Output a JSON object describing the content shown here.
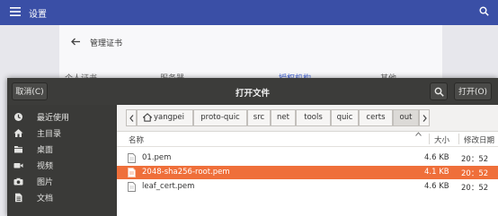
{
  "settings": {
    "title": "设置",
    "page_heading": "管理证书",
    "tabs": [
      {
        "label": "个人证书",
        "active": false
      },
      {
        "label": "服务器",
        "active": false
      },
      {
        "label": "授权机构",
        "active": true
      },
      {
        "label": "其他",
        "active": false
      }
    ]
  },
  "dialog": {
    "title": "打开文件",
    "cancel_label": "取消(C)",
    "open_label": "打开(O)",
    "search_icon": "search-icon",
    "sidebar": [
      {
        "label": "最近使用",
        "icon": "recent-icon"
      },
      {
        "label": "主目录",
        "icon": "home-icon"
      },
      {
        "label": "桌面",
        "icon": "folder-icon"
      },
      {
        "label": "视频",
        "icon": "video-icon"
      },
      {
        "label": "图片",
        "icon": "camera-icon"
      },
      {
        "label": "文档",
        "icon": "document-icon"
      }
    ],
    "breadcrumb": [
      {
        "label": "yangpei",
        "icon": "home-icon",
        "current": false
      },
      {
        "label": "proto-quic",
        "current": false
      },
      {
        "label": "src",
        "current": false
      },
      {
        "label": "net",
        "current": false
      },
      {
        "label": "tools",
        "current": false
      },
      {
        "label": "quic",
        "current": false
      },
      {
        "label": "certs",
        "current": false
      },
      {
        "label": "out",
        "current": true
      }
    ],
    "columns": {
      "name": "名称",
      "size": "大小",
      "modified": "修改日期"
    },
    "files": [
      {
        "name": "01.pem",
        "size": "4.6 KB",
        "modified": "20：52",
        "selected": false
      },
      {
        "name": "2048-sha256-root.pem",
        "size": "4.1 KB",
        "modified": "20：52",
        "selected": true
      },
      {
        "name": "leaf_cert.pem",
        "size": "4.6 KB",
        "modified": "20：52",
        "selected": false
      }
    ]
  },
  "colors": {
    "settings_header": "#3a4fa6",
    "dialog_header": "#3c3c3a",
    "sidebar": "#3a3a38",
    "selection": "#ef6f3a",
    "active_tab": "#4767d8"
  }
}
